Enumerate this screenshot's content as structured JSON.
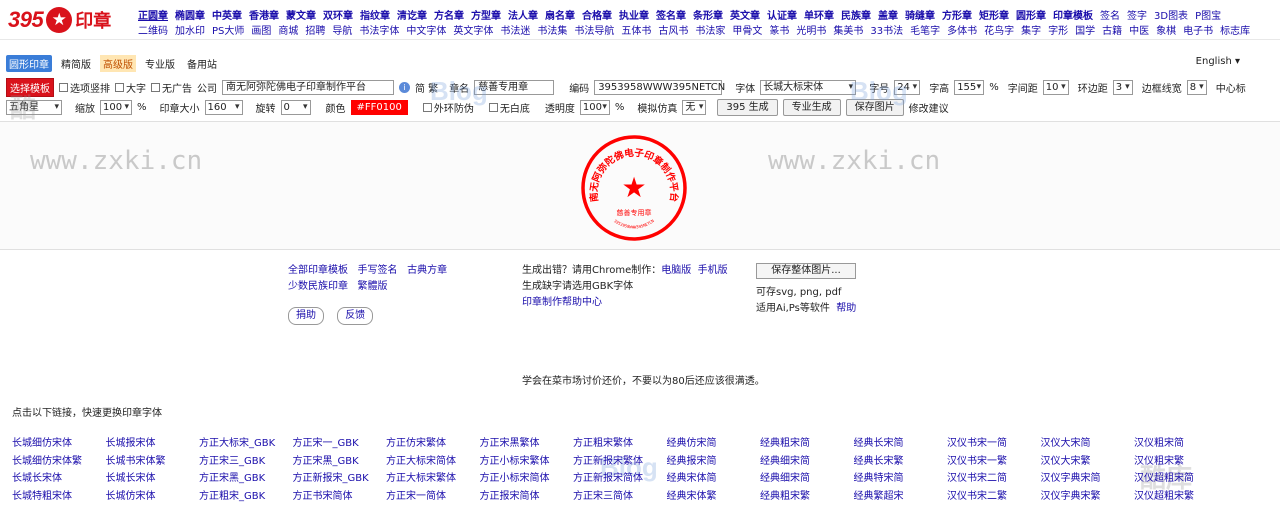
{
  "logo": {
    "number": "395",
    "star": "★",
    "text": "印章"
  },
  "nav": {
    "row1": [
      "正圆章",
      "椭圆章",
      "中英章",
      "香港章",
      "蒙文章",
      "双环章",
      "指纹章",
      "清讫章",
      "方名章",
      "方型章",
      "法人章",
      "扇名章",
      "合格章",
      "执业章",
      "签名章",
      "条形章",
      "英文章",
      "认证章",
      "单环章",
      "民族章",
      "盖章",
      "骑缝章",
      "方形章",
      "矩形章",
      "圆形章",
      "印章模板",
      "签名",
      "签字",
      "3D图表",
      "P图宝"
    ],
    "row2": [
      "二维码",
      "加水印",
      "PS大师",
      "画图",
      "商城",
      "招聘",
      "导航",
      "书法字体",
      "中文字体",
      "英文字体",
      "书法迷",
      "书法集",
      "书法导航",
      "五体书",
      "古风书",
      "书法家",
      "甲骨文",
      "篆书",
      "光明书",
      "集美书",
      "33书法",
      "毛笔字",
      "多体书",
      "花鸟字",
      "集字",
      "字形",
      "国学",
      "古籍",
      "中医",
      "象棋",
      "电子书",
      "标志库"
    ]
  },
  "tabs": [
    "圆形印章",
    "精简版",
    "高级版",
    "专业版",
    "备用站"
  ],
  "language": "English",
  "controls": {
    "template_btn": "选择模板",
    "opt_vertical": "选项竖排",
    "opt_big": "大字",
    "opt_noad": "无广告",
    "company_label": "公司",
    "company_value": "南无阿弥陀佛电子印章制作平台",
    "simp_trad": "简 繁",
    "name_label": "章名",
    "name_value": "慈善专用章",
    "code_label": "编码",
    "code_value": "3953958WWW395NETCN",
    "font_label": "字体",
    "font_value": "长城大标宋体",
    "size_label": "字号",
    "size_value": "24",
    "height_label": "字高",
    "height_value": "155",
    "percent": "%",
    "spacing_label": "字间距",
    "spacing_value": "10",
    "ring_label": "环边距",
    "ring_value": "3",
    "border_label": "边框线宽",
    "border_value": "8",
    "center_label": "中心标",
    "center_value": "五角星",
    "zoom_label": "缩放",
    "zoom_value": "100",
    "stamp_size_label": "印章大小",
    "stamp_size_value": "160",
    "rotate_label": "旋转",
    "rotate_value": "0",
    "color_label": "颜色",
    "color_value": "#FF0100",
    "outer_ring": "外环防伪",
    "no_white": "无白底",
    "opacity_label": "透明度",
    "opacity_value": "100",
    "simulate_label": "模拟仿真",
    "simulate_value": "无",
    "gen_btn": "395 生成",
    "pro_btn": "专业生成",
    "save_btn": "保存图片",
    "suggest": "修改建议"
  },
  "stamp": {
    "company": "南无阿弥陀佛电子印章制作平台",
    "name": "慈善专用章",
    "code": "3953958WWW395NETCN",
    "color": "#ff0100"
  },
  "watermarks": {
    "url": "www.zxki.cn"
  },
  "links": {
    "col1": [
      "全部印章模板",
      "手写签名",
      "古典方章",
      "少数民族印章",
      "繁體版"
    ],
    "donate": "捐助",
    "feedback": "反馈",
    "col2_line1_text": "生成出错？请用Chrome制作：",
    "col2_line1_links": [
      "电脑版",
      "手机版"
    ],
    "col2_line2": "生成缺字请选用GBK字体",
    "col2_line3": "印章制作帮助中心",
    "save_all": "保存整体图片...",
    "col3_line1": "可存svg, png, pdf",
    "col3_line2": "适用Ai,Ps等软件",
    "col3_help": "帮助"
  },
  "notice": "学会在菜市场讨价还价，不要以为80后还应该很满透。",
  "font_heading": "点击以下链接，快速更换印章字体",
  "font_grid": [
    [
      "长城细仿宋体",
      "长城报宋体",
      "方正大标宋_GBK",
      "方正宋一_GBK",
      "方正仿宋繁体",
      "方正宋黑繁体",
      "方正粗宋繁体",
      "经典仿宋简",
      "经典粗宋简",
      "经典长宋简",
      "汉仪书宋一简",
      "汉仪大宋简",
      "汉仪粗宋简"
    ],
    [
      "长城细仿宋体繁",
      "长城书宋体繁",
      "方正宋三_GBK",
      "方正宋黑_GBK",
      "方正大标宋简体",
      "方正小标宋繁体",
      "方正新报宋繁体",
      "经典报宋简",
      "经典细宋简",
      "经典长宋繁",
      "汉仪书宋一繁",
      "汉仪大宋繁",
      "汉仪粗宋繁"
    ],
    [
      "长城长宋体",
      "长城长宋体",
      "方正宋黑_GBK",
      "方正新报宋_GBK",
      "方正大标宋繁体",
      "方正小标宋简体",
      "方正新报宋简体",
      "经典宋体简",
      "经典细宋简",
      "经典特宋简",
      "汉仪书宋二简",
      "汉仪字典宋简",
      "汉仪超粗宋简"
    ],
    [
      "长城特粗宋体",
      "长城仿宋体",
      "方正粗宋_GBK",
      "方正书宋简体",
      "方正宋一简体",
      "方正报宋简体",
      "方正宋三简体",
      "经典宋体繁",
      "经典粗宋繁",
      "经典繁超宋",
      "汉仪书宋二繁",
      "汉仪字典宋繁",
      "汉仪超粗宋繁"
    ]
  ]
}
